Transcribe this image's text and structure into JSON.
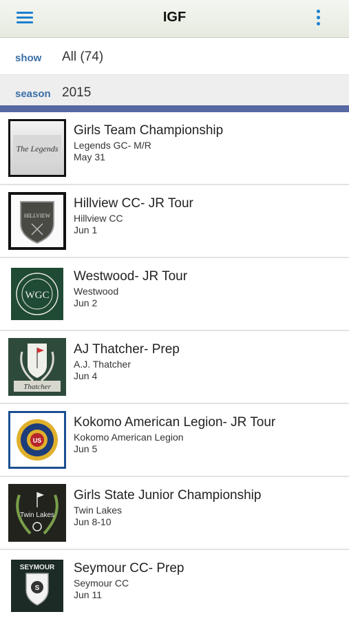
{
  "app": {
    "title": "IGF"
  },
  "filters": {
    "show": {
      "label": "show",
      "value": "All (74)"
    },
    "season": {
      "label": "season",
      "value": "2015"
    }
  },
  "events": [
    {
      "name": "Girls Team Championship",
      "venue": "Legends GC- M/R",
      "date": "May 31",
      "logo_icon": "legends-logo",
      "logo_text": "The Legends"
    },
    {
      "name": "Hillview CC- JR Tour",
      "venue": "Hillview CC",
      "date": "Jun 1",
      "logo_icon": "hillview-logo",
      "logo_text": "HILLVIEW"
    },
    {
      "name": "Westwood- JR Tour",
      "venue": "Westwood",
      "date": "Jun 2",
      "logo_icon": "westwood-logo",
      "logo_text": "WGC"
    },
    {
      "name": "AJ Thatcher- Prep",
      "venue": "A.J. Thatcher",
      "date": "Jun 4",
      "logo_icon": "thatcher-logo",
      "logo_text": "Thatcher"
    },
    {
      "name": "Kokomo American Legion- JR Tour",
      "venue": "Kokomo American Legion",
      "date": "Jun 5",
      "logo_icon": "american-legion-logo",
      "logo_text": "US"
    },
    {
      "name": "Girls State Junior Championship",
      "venue": "Twin Lakes",
      "date": "Jun 8-10",
      "logo_icon": "twin-lakes-logo",
      "logo_text": "Twin Lakes"
    },
    {
      "name": "Seymour CC- Prep",
      "venue": "Seymour CC",
      "date": "Jun 11",
      "logo_icon": "seymour-logo",
      "logo_text": "SEYMOUR"
    }
  ]
}
